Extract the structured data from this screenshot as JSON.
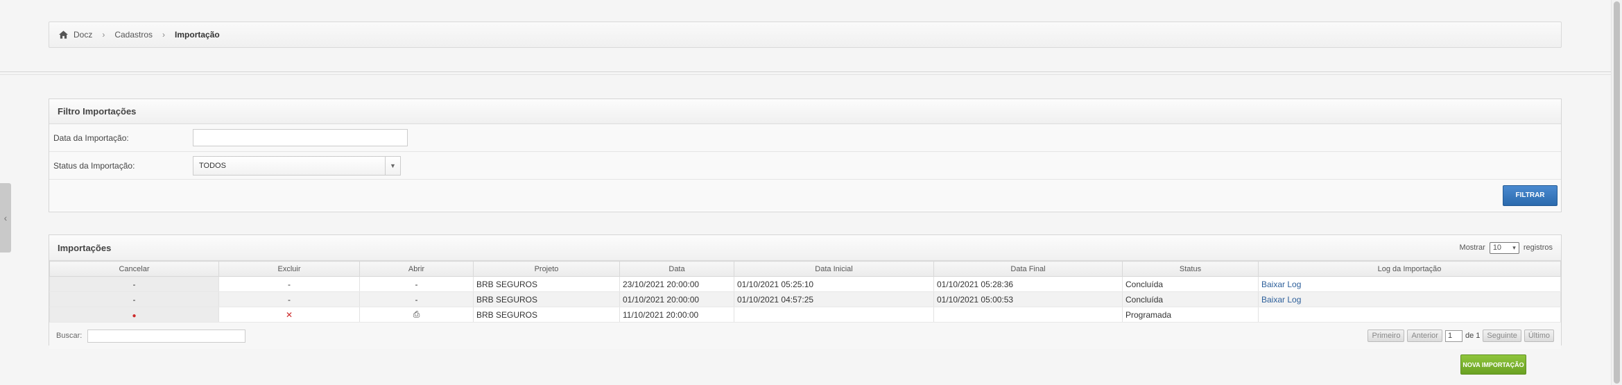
{
  "breadcrumb": {
    "items": [
      "Docz",
      "Cadastros"
    ],
    "current": "Importação"
  },
  "filter": {
    "title": "Filtro Importações",
    "date_label": "Data da Importação:",
    "date_value": "",
    "status_label": "Status da Importação:",
    "status_value": "TODOS",
    "filter_button": "FILTRAR"
  },
  "imports": {
    "title": "Importações",
    "show_label": "Mostrar",
    "show_value": "10",
    "records_label": "registros",
    "columns": [
      "Cancelar",
      "Excluir",
      "Abrir",
      "Projeto",
      "Data",
      "Data Inicial",
      "Data Final",
      "Status",
      "Log da Importação"
    ],
    "rows": [
      {
        "cancelar": "-",
        "excluir": "-",
        "abrir": "-",
        "projeto": "BRB SEGUROS",
        "data": "23/10/2021 20:00:00",
        "data_inicial": "01/10/2021 05:25:10",
        "data_final": "01/10/2021 05:28:36",
        "status": "Concluída",
        "log": "Baixar Log"
      },
      {
        "cancelar": "-",
        "excluir": "-",
        "abrir": "-",
        "projeto": "BRB SEGUROS",
        "data": "01/10/2021 20:00:00",
        "data_inicial": "01/10/2021 04:57:25",
        "data_final": "01/10/2021 05:00:53",
        "status": "Concluída",
        "log": "Baixar Log"
      },
      {
        "cancelar": "●",
        "excluir": "✕",
        "abrir": "⎙",
        "projeto": "BRB SEGUROS",
        "data": "11/10/2021 20:00:00",
        "data_inicial": "",
        "data_final": "",
        "status": "Programada",
        "log": ""
      }
    ],
    "search_label": "Buscar:",
    "search_value": "",
    "pager": {
      "first": "Primeiro",
      "prev": "Anterior",
      "page": "1",
      "of": "de 1",
      "next": "Seguinte",
      "last": "Último"
    }
  },
  "new_button": "NOVA IMPORTAÇÃO",
  "colors": {
    "primary": "#2b6aad",
    "success": "#6aa123",
    "danger": "#cc2a2a",
    "link": "#2d5f9a"
  }
}
